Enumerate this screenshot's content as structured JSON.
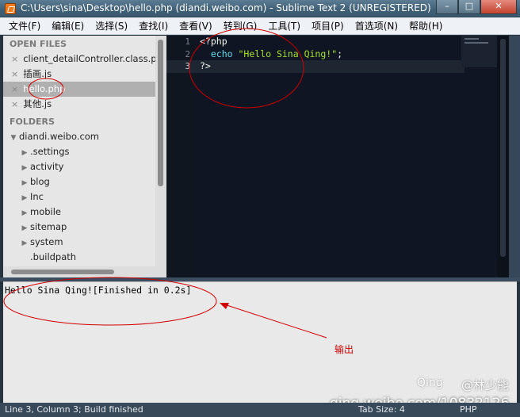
{
  "window": {
    "title": "C:\\Users\\sina\\Desktop\\hello.php (diandi.weibo.com) - Sublime Text 2 (UNREGISTERED)",
    "minimize": "–",
    "maximize": "□",
    "close": "✕"
  },
  "menu": [
    "文件(F)",
    "编辑(E)",
    "选择(S)",
    "查找(I)",
    "查看(V)",
    "转到(G)",
    "工具(T)",
    "项目(P)",
    "首选项(N)",
    "帮助(H)"
  ],
  "sidebar": {
    "open_files_title": "OPEN FILES",
    "open_files": [
      {
        "name": "client_detailController.class.php",
        "selected": false
      },
      {
        "name": "插画.js",
        "selected": false
      },
      {
        "name": "hello.php",
        "selected": true
      },
      {
        "name": "其他.js",
        "selected": false
      }
    ],
    "folders_title": "FOLDERS",
    "project_folder": "diandi.weibo.com",
    "folders": [
      ".settings",
      "activity",
      "blog",
      "Inc",
      "mobile",
      "sitemap",
      "system"
    ],
    "files": [
      ".buildpath"
    ],
    "close_glyph": "×",
    "expand_glyph": "▶",
    "collapse_glyph": "▼"
  },
  "editor": {
    "line_numbers": [
      "1",
      "2",
      "3"
    ],
    "active_line": 3,
    "code": {
      "line1": "<?php",
      "line2_indent": "  ",
      "line2_keyword": "echo",
      "line2_string": "\"Hello Sina Qing!\"",
      "line2_end": ";",
      "line3": "?>"
    }
  },
  "output": {
    "text": "Hello Sina Qing![Finished in 0.2s]",
    "annotation_label": "输出"
  },
  "watermark": {
    "logo": "Qing",
    "weibo_user": "@林少能",
    "url": "qing.weibo.com/10832126"
  },
  "status": {
    "text": "Line 3, Column 3; Build finished",
    "tab_size": "Tab Size: 4",
    "syntax": "PHP"
  },
  "colors": {
    "editor_bg": "#0f1522",
    "keyword": "#66d9ef",
    "string": "#a6e22e",
    "annotation": "#d10000"
  }
}
